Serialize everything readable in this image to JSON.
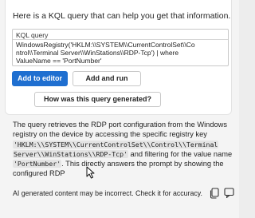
{
  "message": {
    "intro": "Here is a KQL query that can help you get that information."
  },
  "kql": {
    "label": "KQL query",
    "lines": [
      "WindowsRegistry('HKLM:\\\\SYSTEM\\\\CurrentControlSet\\\\Co",
      "ntrol\\\\Terminal Server\\\\WinStations\\\\RDP-Tcp') | where",
      "ValueName == 'PortNumber'"
    ]
  },
  "buttons": {
    "add_to_editor": "Add to editor",
    "add_and_run": "Add and run",
    "how_generated": "How was this query generated?"
  },
  "explanation": {
    "line1": "The query retrieves the RDP port configuration from the Windows",
    "line2": "registry on the device by accessing the specific registry key",
    "line3_code": "'HKLM:\\\\SYSTEM\\\\CurrentControlSet\\\\Control\\\\Terminal",
    "line4_code": "Server\\\\WinStations\\\\RDP-Tcp'",
    "line4_text": " and filtering for the value name",
    "line5_code": "'PortNumber'",
    "line5_text": ". This directly answers the prompt by showing the",
    "line6": "configured RDP"
  },
  "footer": {
    "disclaimer": "AI generated content may be incorrect. Check it for accuracy."
  },
  "icons": {
    "copy": "copy-icon",
    "feedback": "feedback-icon",
    "cursor": "mouse-pointer-icon"
  },
  "colors": {
    "primary": "#1f6fd0",
    "code_bg": "#e4e4e4"
  }
}
